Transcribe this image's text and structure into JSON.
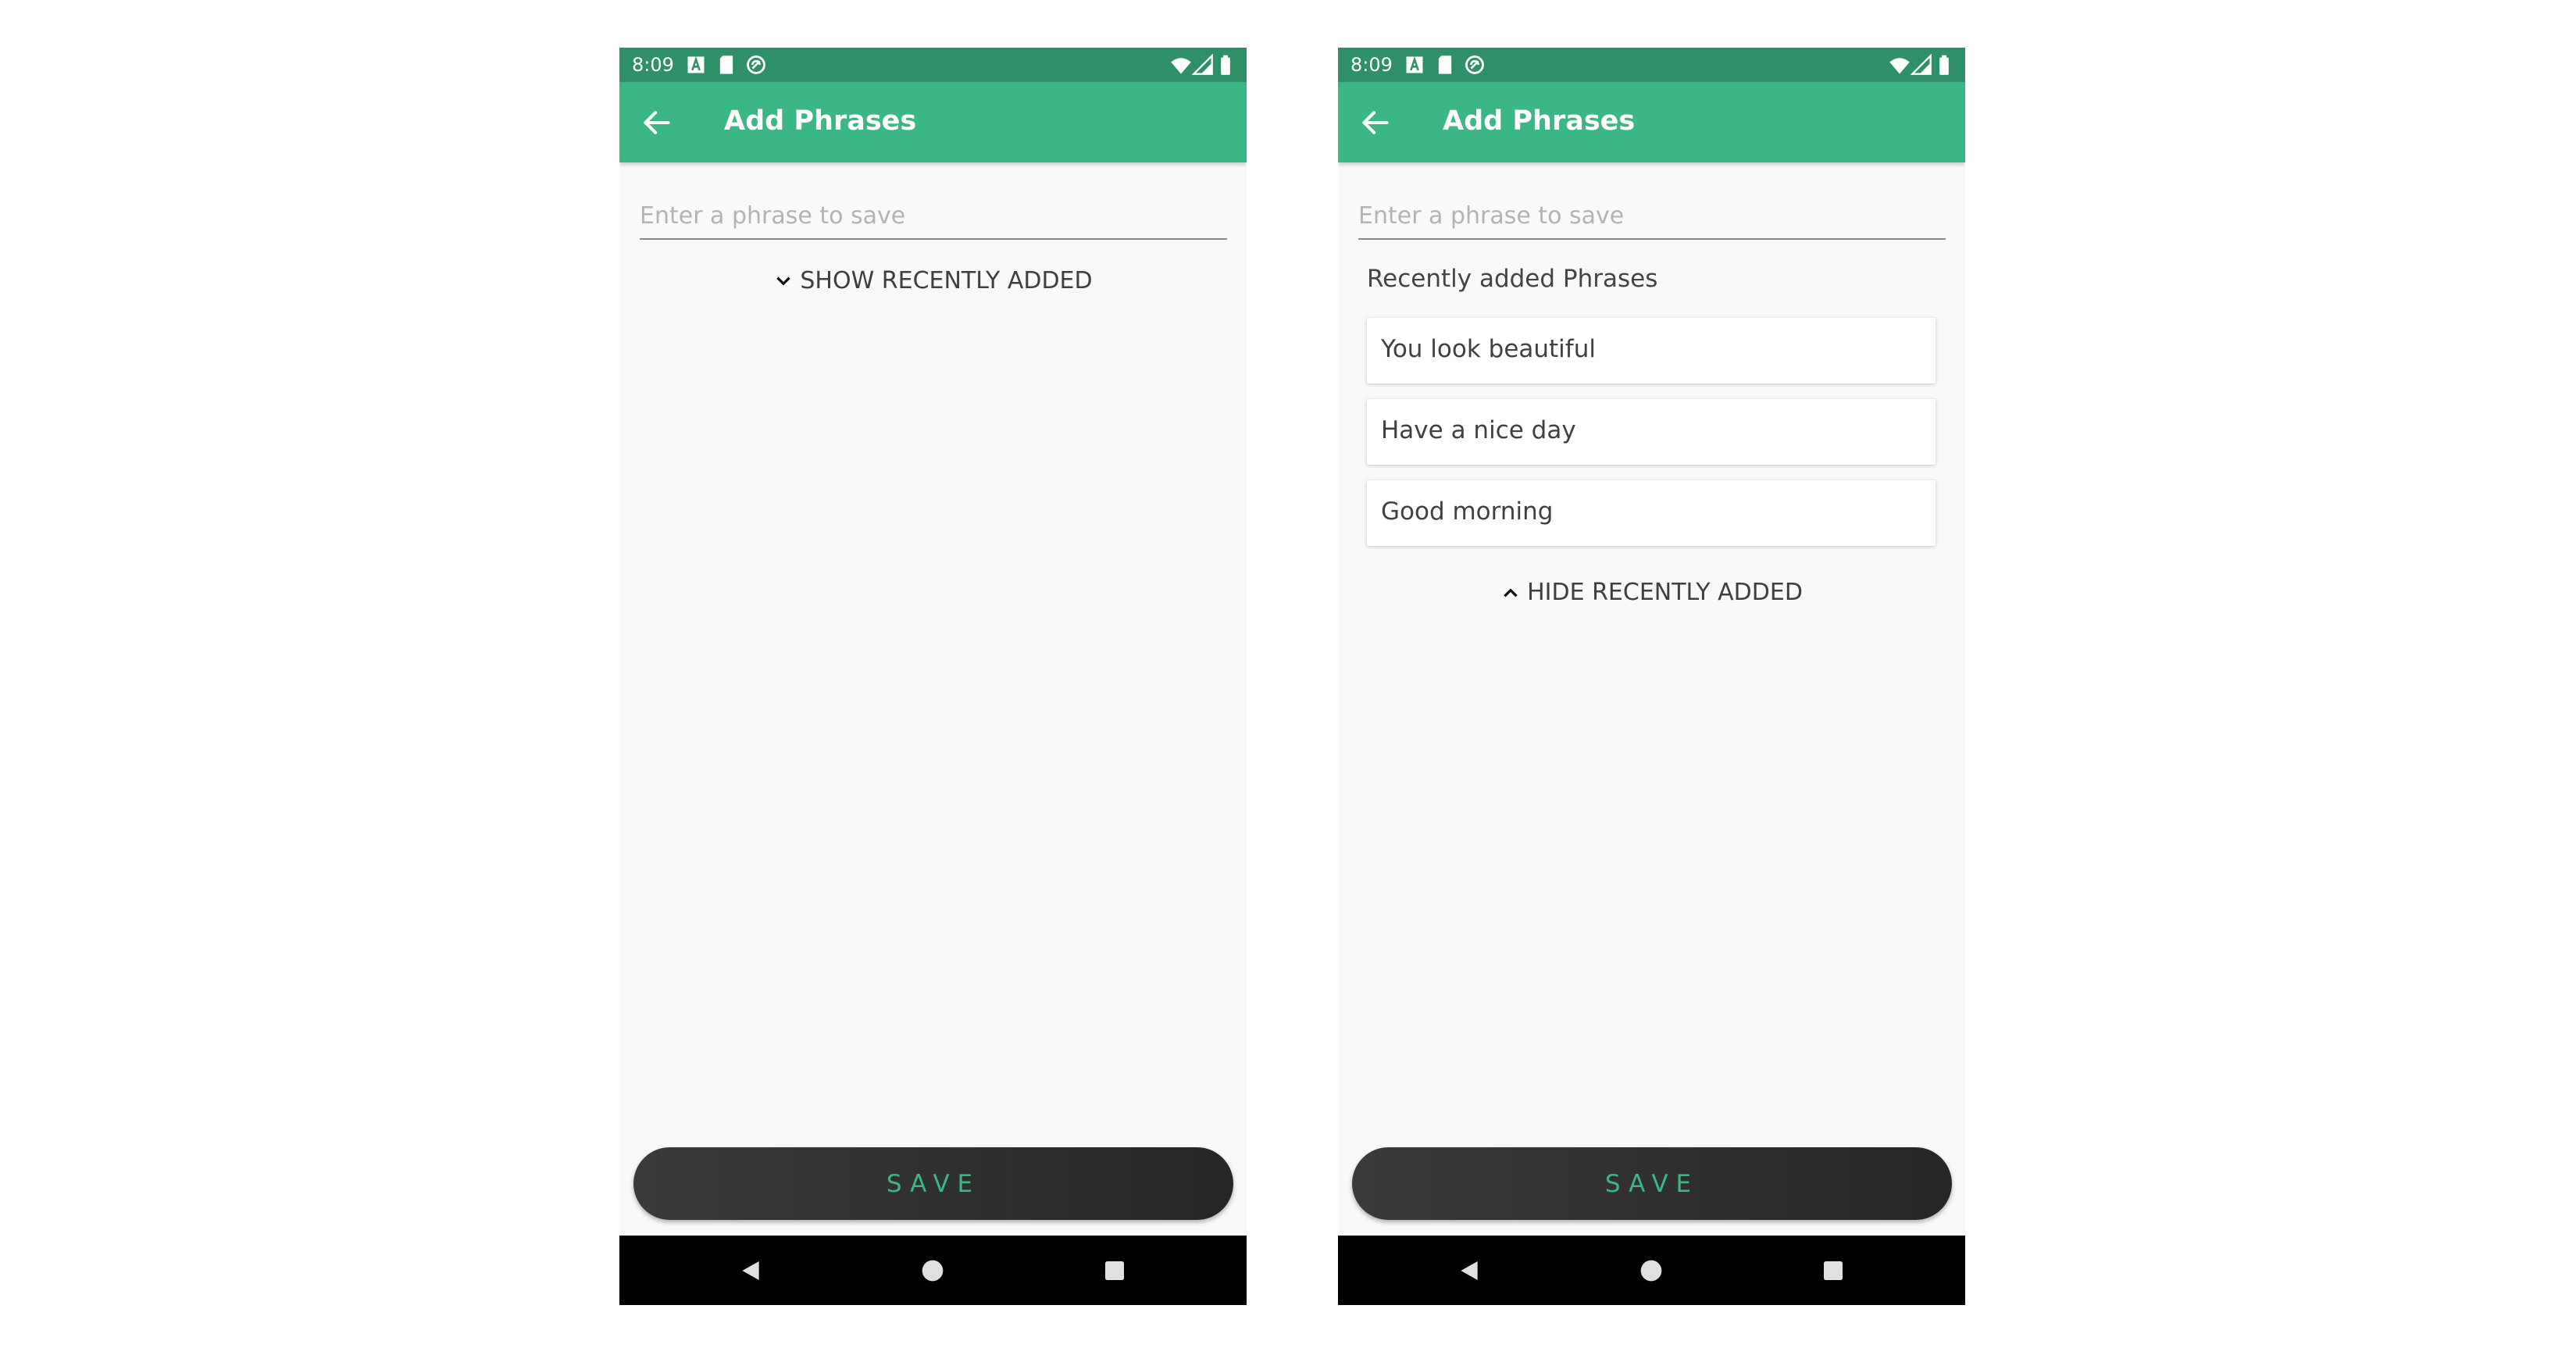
{
  "left": {
    "status": {
      "time": "8:09"
    },
    "appbar": {
      "title": "Add Phrases"
    },
    "input": {
      "placeholder": "Enter a phrase to save",
      "value": ""
    },
    "toggle": {
      "label": "SHOW RECENTLY ADDED",
      "icon": "chevron-down-icon"
    },
    "save_label": "SAVE"
  },
  "right": {
    "status": {
      "time": "8:09"
    },
    "appbar": {
      "title": "Add Phrases"
    },
    "input": {
      "placeholder": "Enter a phrase to save",
      "value": ""
    },
    "recent": {
      "heading": "Recently added Phrases",
      "items": [
        "You look beautiful",
        "Have a nice day",
        "Good morning"
      ]
    },
    "toggle": {
      "label": "HIDE RECENTLY ADDED",
      "icon": "chevron-up-icon"
    },
    "save_label": "SAVE"
  },
  "colors": {
    "accent": "#3bb785",
    "status_bar": "#2f8f68",
    "background": "#f9f9f9",
    "button_dark": "#2c2c2c"
  },
  "icons": [
    "back-arrow-icon",
    "notification-a-icon",
    "sd-card-icon",
    "sync-icon",
    "wifi-icon",
    "signal-icon",
    "battery-icon",
    "nav-back-icon",
    "nav-home-icon",
    "nav-recents-icon"
  ]
}
